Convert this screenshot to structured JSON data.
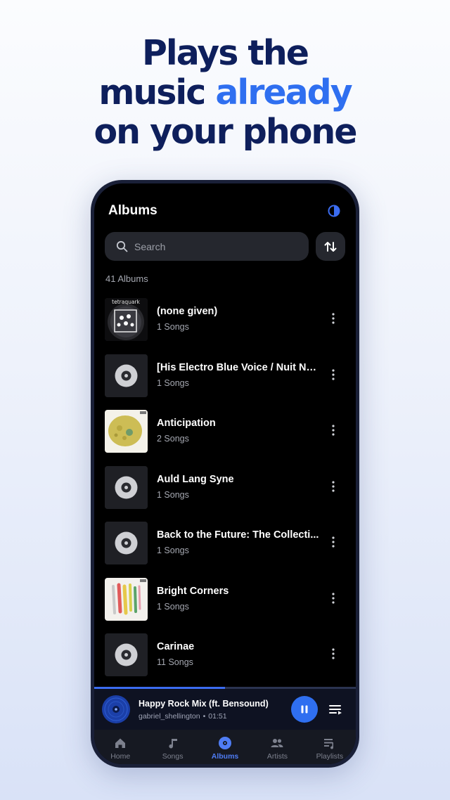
{
  "headline": {
    "line1": "Plays the",
    "line2_start": "music ",
    "line2_accent": "already",
    "line3": "on your phone"
  },
  "colors": {
    "accent": "#2f6ff0",
    "headline": "#0e1f5c",
    "background": "#000000"
  },
  "app": {
    "title": "Albums",
    "theme_icon": "contrast-icon",
    "search": {
      "placeholder": "Search",
      "value": ""
    },
    "sort_icon": "sort-icon",
    "album_count": "41 Albums"
  },
  "albums": [
    {
      "name": "(none given)",
      "songs": "1 Songs",
      "art": "tetraquark"
    },
    {
      "name": "[His Electro Blue Voice / Nuit No...",
      "songs": "1 Songs",
      "art": "disc"
    },
    {
      "name": "Anticipation",
      "songs": "2 Songs",
      "art": "anticipation"
    },
    {
      "name": "Auld Lang Syne",
      "songs": "1 Songs",
      "art": "disc"
    },
    {
      "name": "Back to the Future: The Collecti...",
      "songs": "1 Songs",
      "art": "disc"
    },
    {
      "name": "Bright Corners",
      "songs": "1 Songs",
      "art": "bright-corners"
    },
    {
      "name": "Carinae",
      "songs": "11 Songs",
      "art": "disc"
    }
  ],
  "tetraquark_label": "tetraquark",
  "now_playing": {
    "title": "Happy Rock Mix (ft. Bensound)",
    "artist": "gabriel_shellington",
    "separator": "•",
    "time": "01:51",
    "progress": 0.5
  },
  "nav": [
    {
      "label": "Home",
      "icon": "home-icon",
      "active": false
    },
    {
      "label": "Songs",
      "icon": "music-note-icon",
      "active": false
    },
    {
      "label": "Albums",
      "icon": "album-icon",
      "active": true
    },
    {
      "label": "Artists",
      "icon": "artists-icon",
      "active": false
    },
    {
      "label": "Playlists",
      "icon": "playlists-icon",
      "active": false
    }
  ]
}
